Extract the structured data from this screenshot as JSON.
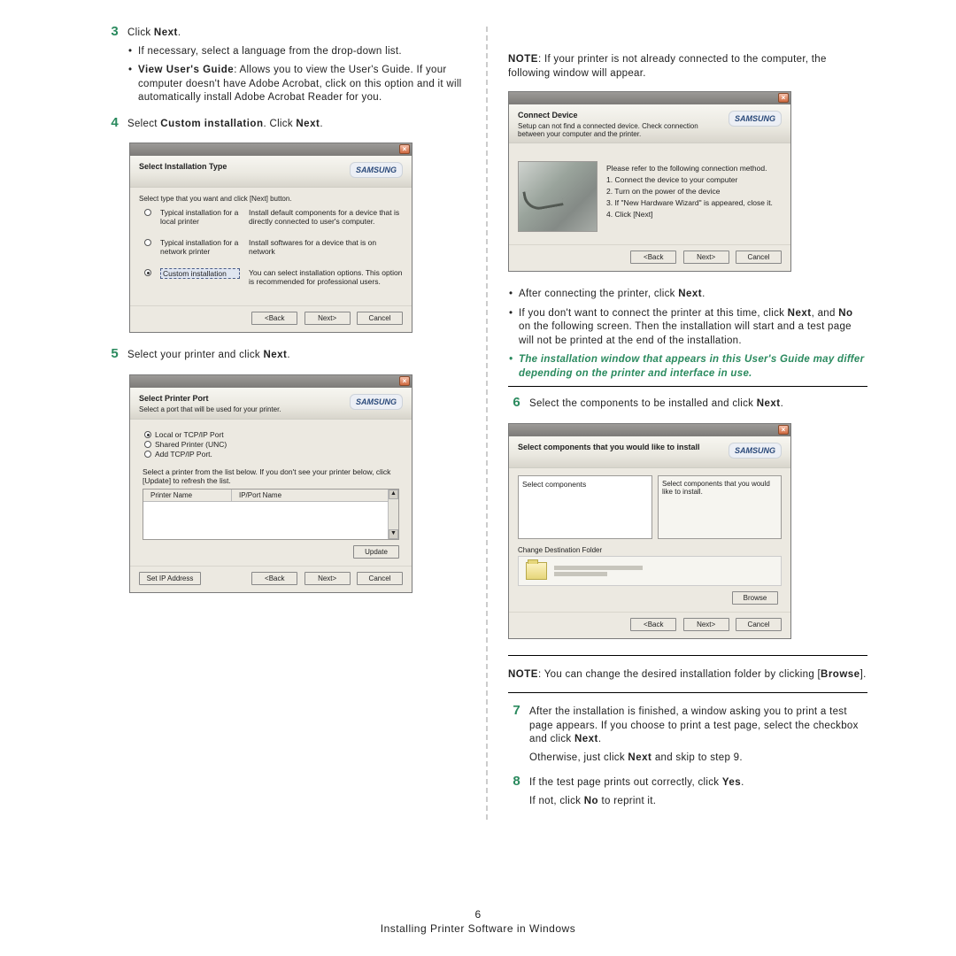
{
  "steps": {
    "s3": {
      "num": "3",
      "line": "Click ",
      "bold": "Next",
      "tail": "."
    },
    "s3_b1": "If necessary, select a language from the drop-down list.",
    "s3_b2a": "View User's Guide",
    "s3_b2b": ": Allows you to view the User's Guide. If your computer doesn't have Adobe Acrobat, click on this option and it will automatically install Adobe Acrobat Reader for you.",
    "s4": {
      "num": "4",
      "a": "Select ",
      "b": "Custom installation",
      "c": ". Click ",
      "d": "Next",
      "e": "."
    },
    "s5": {
      "num": "5",
      "a": "Select your printer and click ",
      "b": "Next",
      "c": "."
    },
    "s6": {
      "num": "6",
      "a": "Select the components to be installed and click ",
      "b": "Next",
      "c": "."
    },
    "s7": {
      "num": "7",
      "a": "After the installation is finished, a window asking you to print a test page appears. If you choose to print a test page, select the checkbox and click ",
      "b": "Next",
      "c": ".",
      "d": "Otherwise, just click ",
      "e": "Next",
      "f": " and skip to step 9."
    },
    "s8": {
      "num": "8",
      "a": "If the test page prints out correctly, click ",
      "b": "Yes",
      "c": ".",
      "d": "If not, click ",
      "e": "No",
      "f": " to reprint it."
    }
  },
  "right": {
    "note1a": "NOTE",
    "note1b": ": If your printer is not already connected to the computer, the following window will appear.",
    "bul1a": "After connecting the printer, click ",
    "bul1b": "Next",
    "bul1c": ".",
    "bul2a": "If you don't want to connect the printer at this time, click ",
    "bul2b": "Next",
    "bul2c": ", and ",
    "bul2d": "No",
    "bul2e": " on the following screen. Then the installation will start and a test page will not be printed at the end of the installation.",
    "bul3": "The installation window that appears in this User's Guide may differ depending on the printer and interface in use.",
    "note2a": "NOTE",
    "note2b": ": You can change the desired installation folder by clicking [",
    "note2c": "Browse",
    "note2d": "]."
  },
  "dlg1": {
    "title": "Select Installation Type",
    "brand": "SAMSUNG",
    "instr": "Select type that you want and click [Next] button.",
    "r1l": "Typical installation for a local printer",
    "r1d": "Install default components for a device that is directly connected to user's computer.",
    "r2l": "Typical installation for a network printer",
    "r2d": "Install softwares for a device that is on network",
    "r3l": "Custom installation",
    "r3d": "You can select installation options. This option is recommended for professional users.",
    "back": "<Back",
    "next": "Next>",
    "cancel": "Cancel"
  },
  "dlg2": {
    "title": "Select Printer Port",
    "sub": "Select a port that will be used for your printer.",
    "brand": "SAMSUNG",
    "o1": "Local or TCP/IP Port",
    "o2": "Shared Printer (UNC)",
    "o3": "Add TCP/IP Port.",
    "instr": "Select a printer from the list below. If you don't see your printer below, click [Update] to refresh the list.",
    "col1": "Printer Name",
    "col2": "IP/Port Name",
    "update": "Update",
    "setip": "Set IP Address",
    "back": "<Back",
    "next": "Next>",
    "cancel": "Cancel"
  },
  "dlg3": {
    "title": "Connect Device",
    "sub": "Setup can not find a connected device. Check connection between your computer and the printer.",
    "brand": "SAMSUNG",
    "lead": "Please refer to the following connection method.",
    "l1": "1. Connect the device to your computer",
    "l2": "2. Turn on the power of the device",
    "l3": "3. If \"New Hardware Wizard\" is appeared, close it.",
    "l4": "4. Click [Next]",
    "back": "<Back",
    "next": "Next>",
    "cancel": "Cancel"
  },
  "dlg4": {
    "title": "Select components that you would like to install",
    "brand": "SAMSUNG",
    "left": "Select components",
    "right": "Select components that you would like to install.",
    "dest": "Change Destination Folder",
    "browse": "Browse",
    "back": "<Back",
    "next": "Next>",
    "cancel": "Cancel"
  },
  "footer": {
    "page": "6",
    "title": "Installing Printer Software in Windows"
  }
}
